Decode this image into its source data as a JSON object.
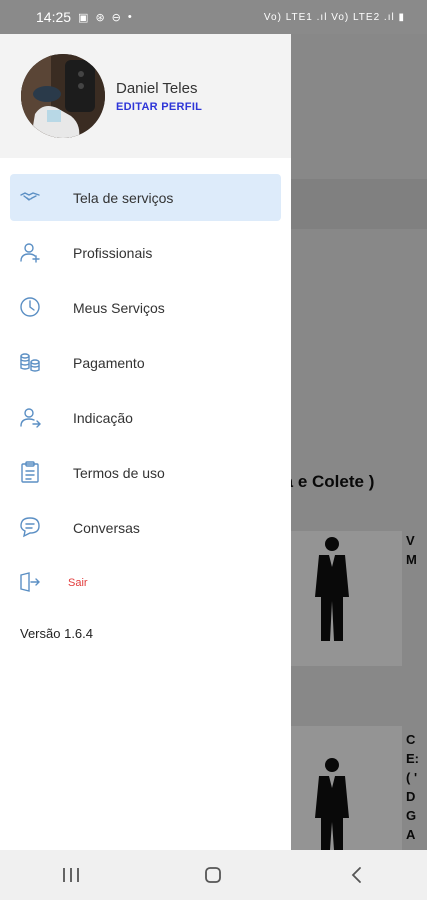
{
  "status_bar": {
    "time": "14:25",
    "right_indicators": "Vo) LTE1 .ıl  Vo) LTE2 .ıl  ▮"
  },
  "background": {
    "category_title": "ta e Colete )",
    "card1_text": "V\nM",
    "card2_text": "C\nE:\n( '\nD\nG\nA"
  },
  "drawer": {
    "user": {
      "name": "Daniel Teles",
      "edit_label": "EDITAR PERFIL"
    },
    "menu": [
      {
        "label": "Tela de serviços",
        "icon": "handshake-icon",
        "active": true
      },
      {
        "label": "Profissionais",
        "icon": "user-add-icon",
        "active": false
      },
      {
        "label": "Meus Serviços",
        "icon": "clock-icon",
        "active": false
      },
      {
        "label": "Pagamento",
        "icon": "coins-icon",
        "active": false
      },
      {
        "label": "Indicação",
        "icon": "user-refer-icon",
        "active": false
      },
      {
        "label": "Termos de uso",
        "icon": "clipboard-icon",
        "active": false
      },
      {
        "label": "Conversas",
        "icon": "chat-icon",
        "active": false
      },
      {
        "label": "Sair",
        "icon": "logout-icon",
        "active": false
      }
    ],
    "version": "Versão 1.6.4"
  },
  "colors": {
    "accent": "#2e35d8",
    "active_bg": "#ddebfa",
    "logout": "#e23b3b",
    "icon": "#5b8fc4"
  }
}
